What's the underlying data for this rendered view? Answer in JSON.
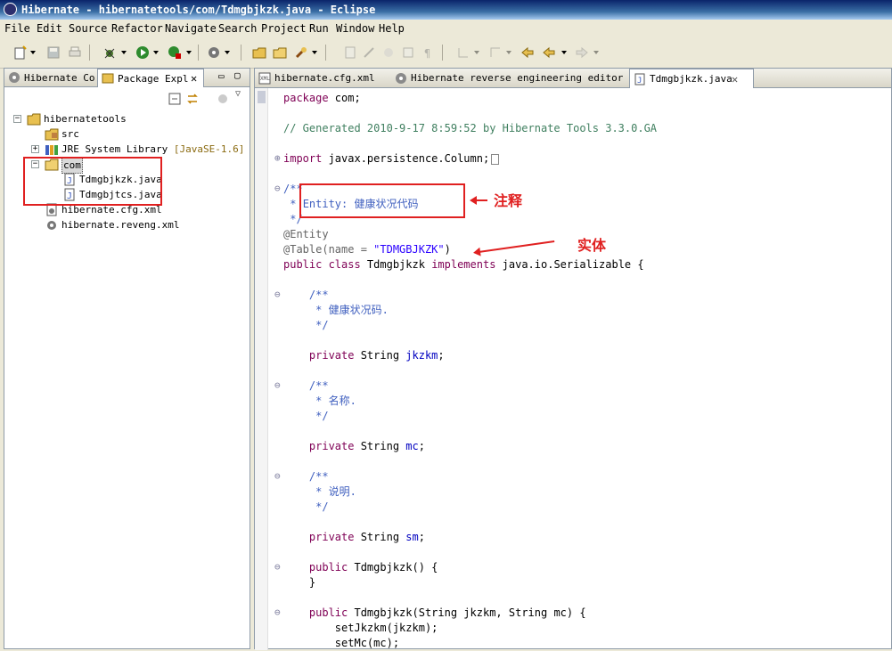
{
  "window": {
    "title": "Hibernate - hibernatetools/com/Tdmgbjkzk.java - Eclipse"
  },
  "menu": [
    "File",
    "Edit",
    "Source",
    "Refactor",
    "Navigate",
    "Search",
    "Project",
    "Run",
    "Window",
    "Help"
  ],
  "left_view": {
    "tabs": [
      {
        "label": "Hibernate Co"
      },
      {
        "label": "Package Expl"
      }
    ],
    "tree": [
      {
        "label": "hibernatetools",
        "icon": "project-icon"
      },
      {
        "label": "src",
        "icon": "source-folder-icon"
      },
      {
        "label": "JRE System Library",
        "decoration": "[JavaSE-1.6]",
        "icon": "library-icon"
      },
      {
        "label": "com",
        "icon": "package-icon"
      },
      {
        "label": "Tdmgbjkzk.java",
        "icon": "java-file-icon"
      },
      {
        "label": "Tdmgbjtcs.java",
        "icon": "java-file-icon"
      },
      {
        "label": "hibernate.cfg.xml",
        "icon": "xml-file-icon"
      },
      {
        "label": "hibernate.reveng.xml",
        "icon": "reveng-file-icon"
      }
    ]
  },
  "editor": {
    "tabs": [
      {
        "label": "hibernate.cfg.xml"
      },
      {
        "label": "Hibernate reverse engineering editor"
      },
      {
        "label": "Tdmgbjkzk.java"
      }
    ],
    "lines": {
      "l1": "package",
      "l1b": " com;",
      "l3": "// Generated 2010-9-17 8:59:52 by Hibernate Tools 3.3.0.GA",
      "l5a": "import",
      "l5b": " javax.persistence.Column;",
      "l7": "/**",
      "l8a": " * ",
      "l8b": "Entity: 健康状况代码",
      "l9": " */",
      "l10": "@Entity",
      "l11a": "@Table(name = ",
      "l11b": "\"TDMGBJKZK\"",
      "l11c": ")",
      "l12a": "public class",
      "l12b": " Tdmgbjkzk ",
      "l12c": "implements",
      "l12d": " java.io.Serializable {",
      "l14": "    /**",
      "l15": "     * 健康状况码.",
      "l16": "     */",
      "l18a": "    private",
      "l18b": " String ",
      "l18c": "jkzkm",
      "l18d": ";",
      "l20": "    /**",
      "l21": "     * 名称.",
      "l22": "     */",
      "l24a": "    private",
      "l24b": " String ",
      "l24c": "mc",
      "l24d": ";",
      "l26": "    /**",
      "l27": "     * 说明.",
      "l28": "     */",
      "l30a": "    private",
      "l30b": " String ",
      "l30c": "sm",
      "l30d": ";",
      "l32a": "    public",
      "l32b": " Tdmgbjkzk() {",
      "l33": "    }",
      "l35a": "    public",
      "l35b": " Tdmgbjkzk(String jkzkm, String mc) {",
      "l36": "        setJkzkm(jkzkm);",
      "l37": "        setMc(mc);"
    }
  },
  "annotations": {
    "comment_note": "注释",
    "entity_note": "实体"
  },
  "colors": {
    "keyword": "#7f0055",
    "comment": "#3f7f5f",
    "javadoc": "#3f5fbf",
    "field": "#0000c0",
    "string": "#2a00ff",
    "highlight": "#e02020"
  }
}
